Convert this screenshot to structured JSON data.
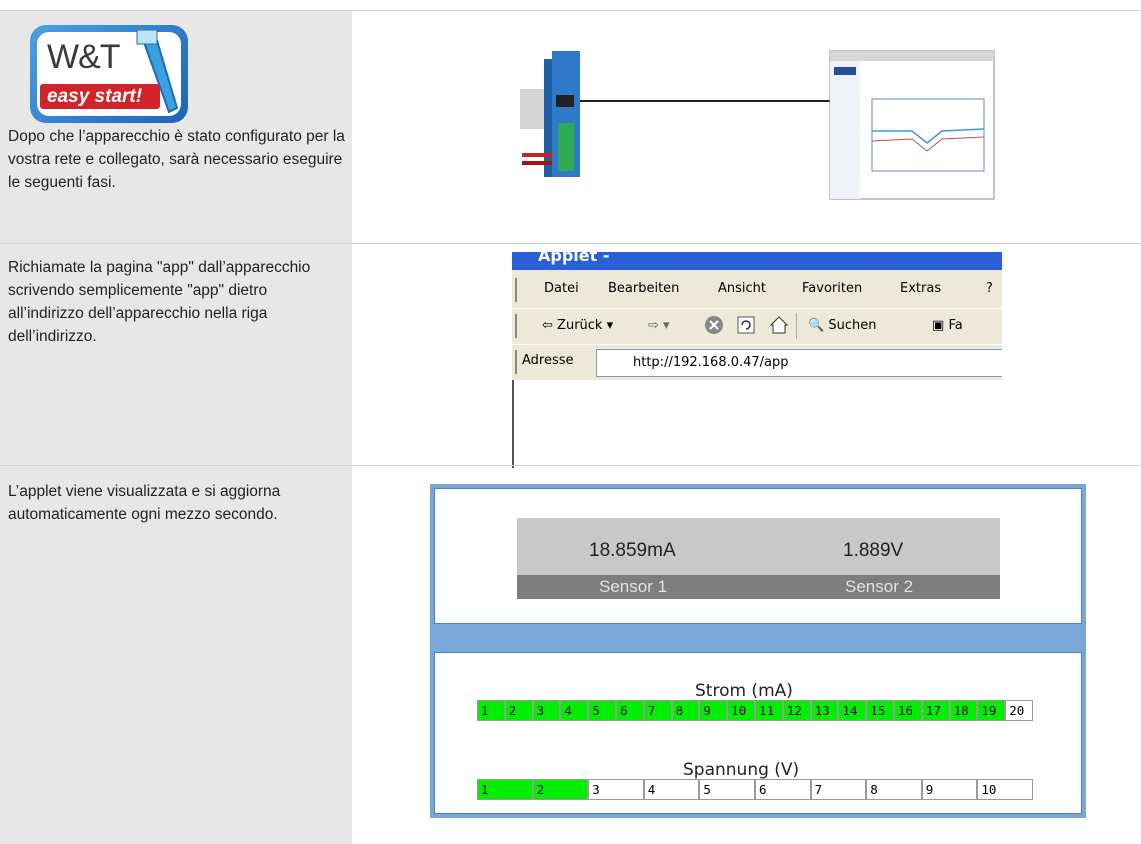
{
  "row1": {
    "logo": {
      "brand": "W&T",
      "tagline": "easy start!"
    },
    "text": "Dopo che l’apparecchio è stato configurato per la vostra rete e collegato, sarà necessario eseguire le seguenti fasi."
  },
  "row2": {
    "text": "Richiamate la pagina \"app\" dall’apparecchio scrivendo semplicemente \"app\" dietro all’indirizzo dell’apparecchio nella riga dell’indirizzo.",
    "browser": {
      "title": "Applet -",
      "menu": [
        "Datei",
        "Bearbeiten",
        "Ansicht",
        "Favoriten",
        "Extras",
        "?"
      ],
      "toolbar": {
        "back": "Zurück",
        "search": "Suchen",
        "favorites": "Fa"
      },
      "address_label": "Adresse",
      "address_value": "http://192.168.0.47/app"
    }
  },
  "row3": {
    "text": "L’applet viene visualizzata e si aggiorna automaticamente ogni mezzo secondo.",
    "applet": {
      "sensor1": {
        "value": "18.859mA",
        "label": "Sensor 1"
      },
      "sensor2": {
        "value": "1.889V",
        "label": "Sensor 2"
      },
      "strom": {
        "title": "Strom (mA)",
        "segments": [
          "1",
          "2",
          "3",
          "4",
          "5",
          "6",
          "7",
          "8",
          "9",
          "10",
          "11",
          "12",
          "13",
          "14",
          "15",
          "16",
          "17",
          "18",
          "19",
          "20"
        ],
        "lit_count": 19
      },
      "spannung": {
        "title": "Spannung (V)",
        "segments": [
          "1",
          "2",
          "3",
          "4",
          "5",
          "6",
          "7",
          "8",
          "9",
          "10"
        ],
        "lit_count": 2
      }
    }
  },
  "colors": {
    "lit": "#00ee00",
    "unlit": "#ffffff",
    "left_cell": "#e7e7e7",
    "applet_frame": "#7ba7d8"
  }
}
